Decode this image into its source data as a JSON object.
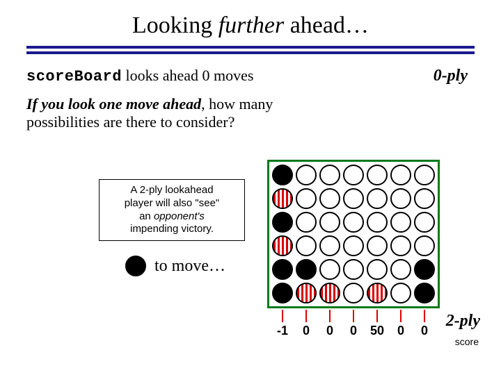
{
  "title_prefix": "Looking ",
  "title_emph": "further",
  "title_suffix": " ahead…",
  "score_board_code": "scoreBoard",
  "score_board_tail": " looks ahead 0 moves",
  "zero_ply": "0-ply",
  "question_lead": "If you look one move ahead",
  "question_tail": ", how many possibilities are there to consider?",
  "note_line1": "A 2-ply lookahead",
  "note_line2": "player will also \"see\"",
  "note_line3_prefix": "an ",
  "note_line3_emph": "opponent's",
  "note_line4": "impending victory.",
  "to_move": " to move…",
  "two_ply": "2-ply",
  "score_label": "score",
  "board": [
    [
      "black",
      "empty",
      "empty",
      "empty",
      "empty",
      "empty",
      "empty"
    ],
    [
      "red",
      "empty",
      "empty",
      "empty",
      "empty",
      "empty",
      "empty"
    ],
    [
      "black",
      "empty",
      "empty",
      "empty",
      "empty",
      "empty",
      "empty"
    ],
    [
      "red",
      "empty",
      "empty",
      "empty",
      "empty",
      "empty",
      "empty"
    ],
    [
      "black",
      "black",
      "empty",
      "empty",
      "empty",
      "empty",
      "black"
    ],
    [
      "black",
      "red",
      "red",
      "empty",
      "red",
      "empty",
      "black"
    ]
  ],
  "col_scores": [
    "-1",
    "0",
    "0",
    "0",
    "50",
    "0",
    "0"
  ]
}
